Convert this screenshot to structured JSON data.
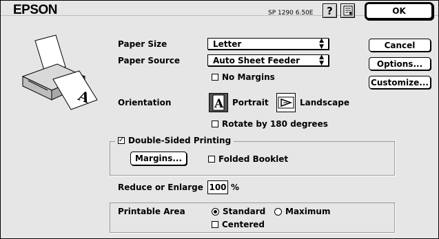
{
  "header": {
    "logo": "EPSON",
    "version": "SP 1290 6.50E",
    "help_icon": "question-mark-icon",
    "info_icon": "printer-info-icon"
  },
  "buttons": {
    "ok": "OK",
    "cancel": "Cancel",
    "options": "Options...",
    "customize": "Customize..."
  },
  "paper_size": {
    "label": "Paper Size",
    "value": "Letter"
  },
  "paper_source": {
    "label": "Paper Source",
    "value": "Auto Sheet Feeder"
  },
  "no_margins": {
    "label": "No Margins",
    "checked": false
  },
  "orientation": {
    "label": "Orientation",
    "portrait": "Portrait",
    "landscape": "Landscape",
    "selected": "Portrait"
  },
  "rotate": {
    "label": "Rotate by 180 degrees",
    "checked": false
  },
  "double_sided": {
    "label": "Double-Sided Printing",
    "checked": true,
    "margins_button": "Margins...",
    "folded_booklet": "Folded Booklet"
  },
  "reduce": {
    "label": "Reduce or Enlarge",
    "value": "100",
    "unit": "%"
  },
  "printable_area": {
    "label": "Printable Area",
    "standard": "Standard",
    "maximum": "Maximum",
    "selected": "Standard",
    "centered": "Centered"
  }
}
